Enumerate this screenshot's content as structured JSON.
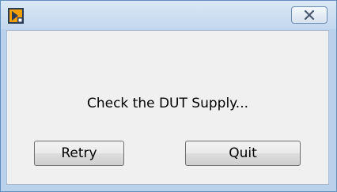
{
  "dialog": {
    "message": "Check the DUT Supply...",
    "retry_label": "Retry",
    "quit_label": "Quit"
  },
  "titlebar": {
    "app_icon": "labview-vi-icon",
    "close_icon": "close-icon"
  },
  "colors": {
    "frame": "#b9d1ea",
    "client_bg": "#f0f0f0",
    "button_border": "#707070",
    "icon_orange": "#f2a000",
    "icon_dark": "#2b3a55"
  }
}
